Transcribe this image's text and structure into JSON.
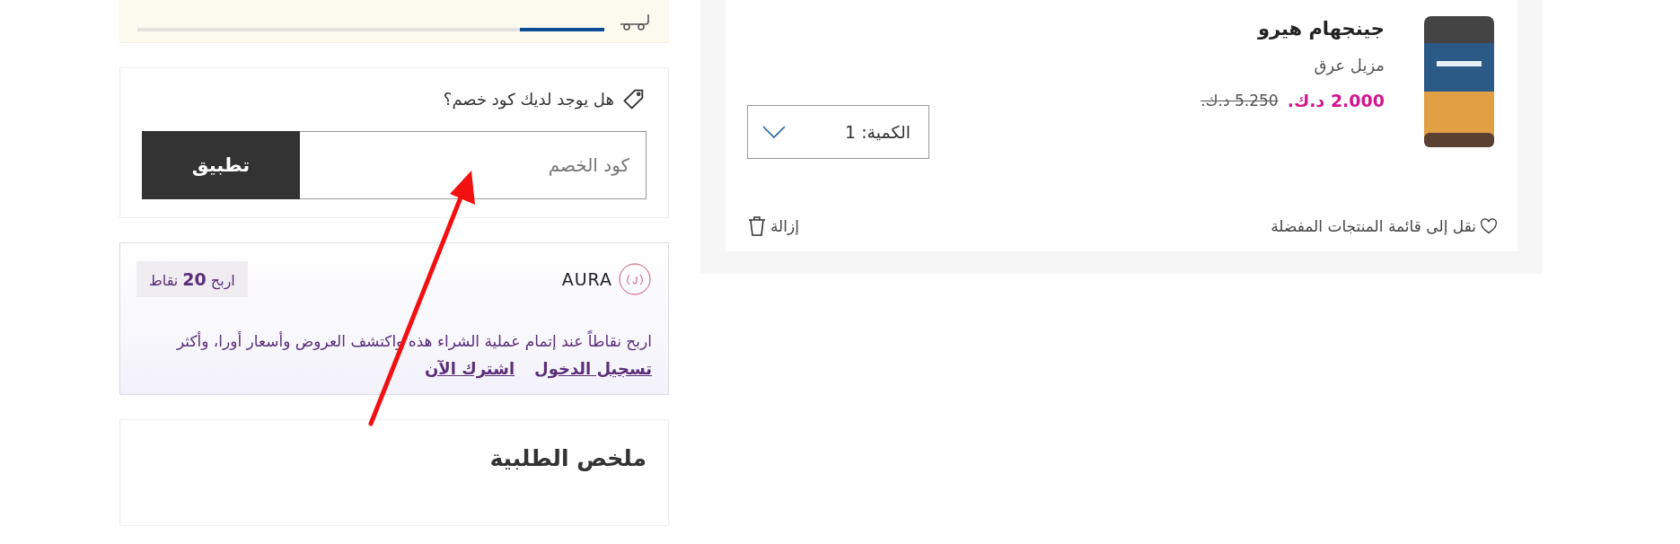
{
  "shipping_banner": {
    "level": 0.18
  },
  "coupon": {
    "question": "هل يوجد لديك كود خصم؟",
    "placeholder": "كود الخصم",
    "apply_button": "تطبيق"
  },
  "aura": {
    "brand": "AURA",
    "points_badge": "اربح **20** نقاط",
    "message": "اربح نقاطاً عند إتمام عملية الشراء هذه واكتشف العروض وأسعار أورا، وأكثر",
    "links": [
      "تسجيل الدخول",
      "اشترك الآن"
    ]
  },
  "order_summary": {
    "title": "ملخص الطلبية"
  },
  "cart_item": {
    "name": "جينجهام هيرو",
    "subtitle": "مزيل عرق",
    "price": "2.000 د.ك.",
    "old_price": "5.250 د.ك.",
    "quantity": "الكمية: 1",
    "wishlist": "نقل إلى قائمة المنتجات المفضلة",
    "remove": "إزالة"
  }
}
